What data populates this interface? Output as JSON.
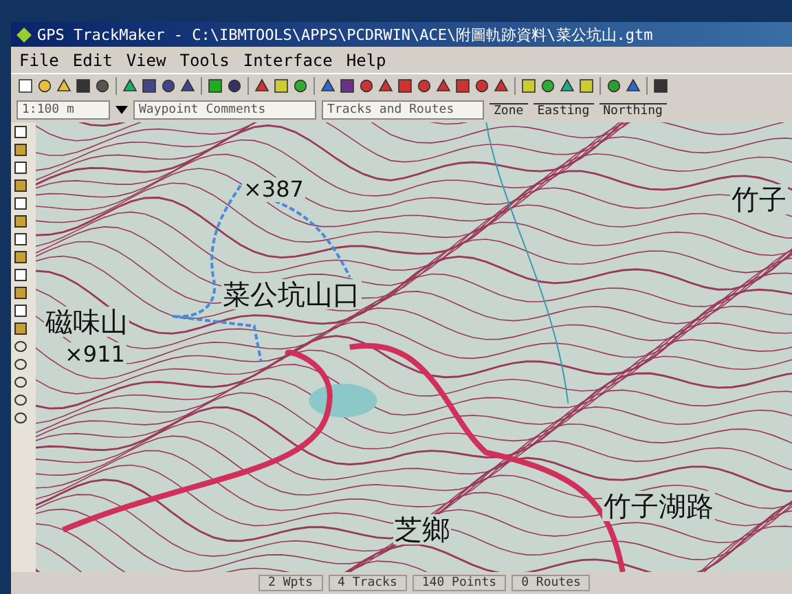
{
  "window": {
    "title": "GPS TrackMaker - C:\\IBMTOOLS\\APPS\\PCDRWIN\\ACE\\附圖軌跡資料\\菜公坑山.gtm"
  },
  "menu": [
    "File",
    "Edit",
    "View",
    "Tools",
    "Interface",
    "Help"
  ],
  "toolbar2": {
    "scale": "1:100 m",
    "waypoint_field": "Waypoint Comments",
    "tracks_field": "Tracks and Routes",
    "coord_headers": [
      "Zone",
      "Easting",
      "Northing"
    ]
  },
  "map": {
    "labels": [
      {
        "kind": "peak",
        "text": "×387"
      },
      {
        "kind": "name",
        "text": "菜公坑山口"
      },
      {
        "kind": "name",
        "text": "磁味山"
      },
      {
        "kind": "peak",
        "text": "×911"
      },
      {
        "kind": "name",
        "text": "竹子"
      },
      {
        "kind": "name",
        "text": "竹子湖路"
      },
      {
        "kind": "name",
        "text": "芝鄉"
      }
    ]
  },
  "status_bar": [
    "2 Wpts",
    "4 Tracks",
    "140 Points",
    "0 Routes"
  ]
}
